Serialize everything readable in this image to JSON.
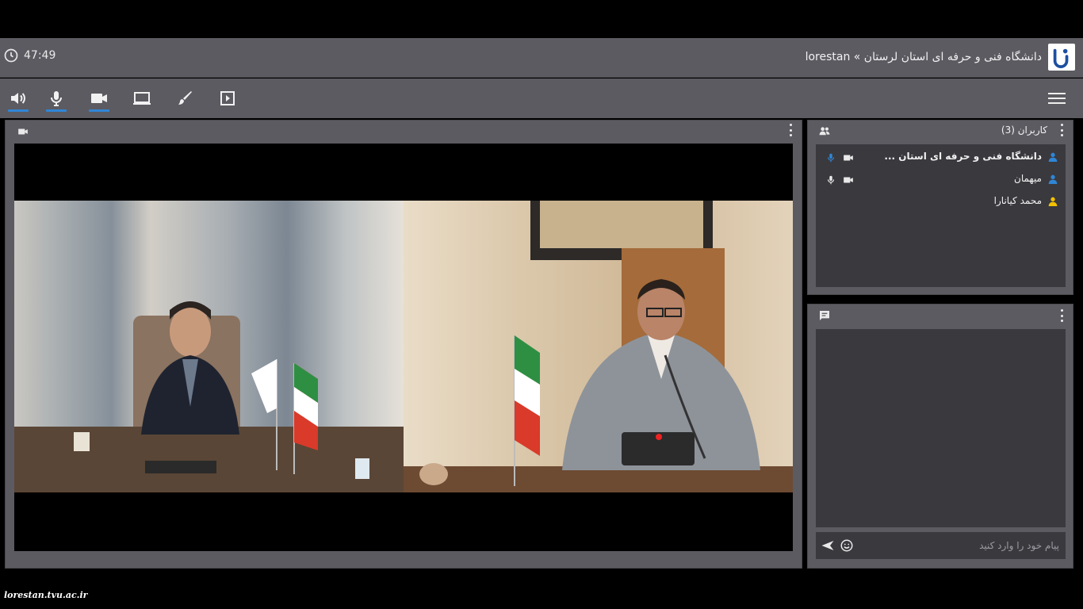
{
  "header": {
    "timer": "47:49",
    "title": "دانشگاه فنی و حرفه ای استان لرستان » lorestan"
  },
  "toolbar": {
    "buttons": [
      "speaker-icon",
      "mic-icon",
      "camera-icon",
      "screen-share-icon",
      "whiteboard-icon",
      "presentation-icon"
    ],
    "active": [
      "speaker-icon",
      "mic-icon",
      "camera-icon"
    ],
    "accent": "#2f86d6"
  },
  "users": {
    "title": "کاربران (3)",
    "list": [
      {
        "name": "دانشگاه فنی و حرفه ای استان ...",
        "role_color": "#2f86d6",
        "mic": "active",
        "cam": true
      },
      {
        "name": "میهمان",
        "role_color": "#2f86d6",
        "mic": "on",
        "cam": true
      },
      {
        "name": "محمد کیانارا",
        "role_color": "#f2c200",
        "mic": null,
        "cam": false
      }
    ]
  },
  "chat": {
    "placeholder": "پیام خود را وارد کنید"
  },
  "watermark": "lorestan.tvu.ac.ir",
  "colors": {
    "panel": "#5c5b61",
    "panel_inner": "#3a393e"
  }
}
